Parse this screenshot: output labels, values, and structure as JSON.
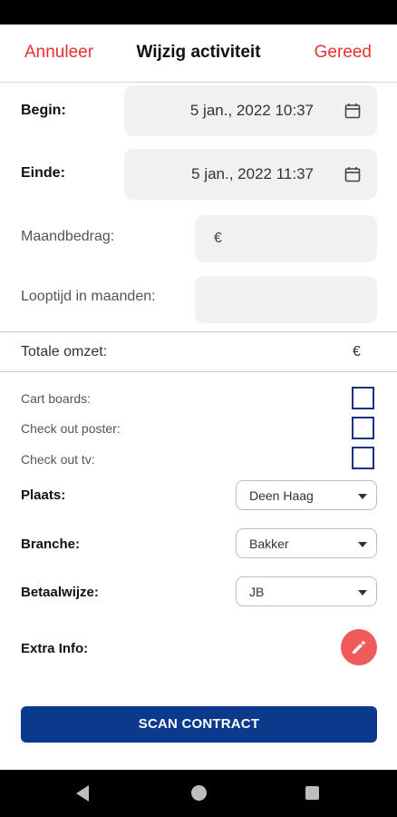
{
  "header": {
    "cancel_label": "Annuleer",
    "title": "Wijzig activiteit",
    "done_label": "Gereed"
  },
  "begin": {
    "label": "Begin:",
    "value": "5 jan., 2022 10:37"
  },
  "end": {
    "label": "Einde:",
    "value": "5 jan., 2022 11:37"
  },
  "monthly_amount": {
    "label": "Maandbedrag:",
    "prefix": "€",
    "value": ""
  },
  "duration": {
    "label": "Looptijd in maanden:",
    "value": ""
  },
  "total": {
    "label": "Totale omzet:",
    "currency": "€"
  },
  "checkboxes": [
    {
      "label": "Cart boards:",
      "checked": false
    },
    {
      "label": "Check out poster:",
      "checked": false
    },
    {
      "label": "Check out tv:",
      "checked": false
    }
  ],
  "place": {
    "label": "Plaats:",
    "value": "Deen Haag"
  },
  "branch": {
    "label": "Branche:",
    "value": "Bakker"
  },
  "payment": {
    "label": "Betaalwijze:",
    "value": "JB"
  },
  "extra_info": {
    "label": "Extra Info:",
    "icon": "pencil-icon"
  },
  "scan_button": {
    "label": "SCAN CONTRACT"
  },
  "colors": {
    "accent_red": "#e8322f",
    "primary_blue": "#0b3a8c",
    "checkbox_border": "#1a2f86",
    "edit_button": "#f05a5a"
  }
}
